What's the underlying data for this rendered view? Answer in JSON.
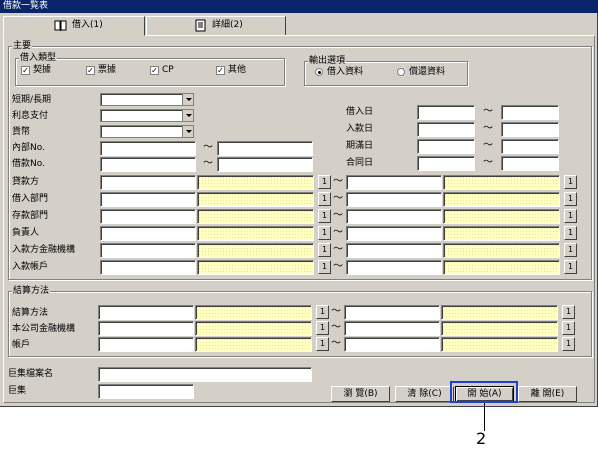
{
  "title": "借款一覧表",
  "tabs": [
    {
      "label": "借入(1)"
    },
    {
      "label": "詳細(2)"
    }
  ],
  "main_group": {
    "label": "主要"
  },
  "type_group": {
    "label": "借入類型",
    "options": [
      {
        "label": "契據",
        "checked": true
      },
      {
        "label": "票據",
        "checked": true
      },
      {
        "label": "CP",
        "checked": true
      },
      {
        "label": "其他",
        "checked": true
      }
    ]
  },
  "output_group": {
    "label": "輸出選項",
    "options": [
      {
        "label": "借入資料",
        "selected": true
      },
      {
        "label": "償還資料",
        "selected": false
      }
    ]
  },
  "left_fields": {
    "term": "短期/長期",
    "interest": "利息支付",
    "currency": "貨幣",
    "internal_no": "內部No.",
    "loan_no": "借款No."
  },
  "right_dates": [
    "借入日",
    "入款日",
    "期滿日",
    "合同日"
  ],
  "range_rows": [
    "貸款方",
    "借入部門",
    "存款部門",
    "負責人",
    "入款方金融機構",
    "入款帳戶"
  ],
  "settle_group": {
    "label": "結算方法",
    "rows": [
      "結算方法",
      "本公司金融機構",
      "帳戶"
    ]
  },
  "btn_1": "1",
  "tilde": "～",
  "bottom": {
    "file_name_label": "巨集檔案名",
    "macro_label": "巨集"
  },
  "buttons": {
    "browse": "瀏 覽(B)",
    "clear": "清 除(C)",
    "start": "開 始(A)",
    "close": "離 開(E)"
  },
  "callout": "2",
  "colors": {
    "titlebar": "#0a246a",
    "window": "#d4d0c8",
    "highlight": "#1f40d0",
    "yellow_field": "#ffffc0"
  }
}
